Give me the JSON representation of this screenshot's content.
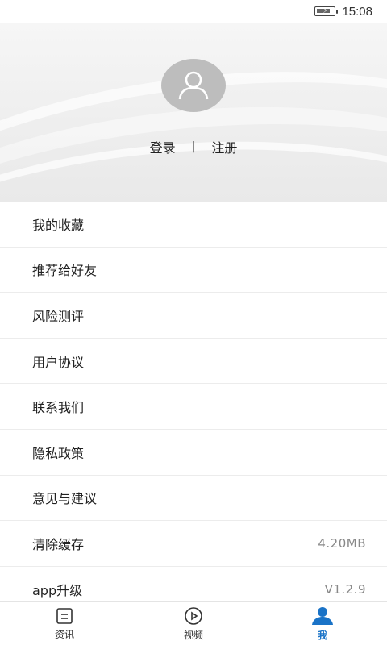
{
  "statusbar": {
    "time": "15:08",
    "battery_icon": "battery-charging-icon"
  },
  "profile": {
    "avatar_icon": "user-avatar-icon",
    "login_label": "登录",
    "separator": "|",
    "register_label": "注册"
  },
  "menu": {
    "items": [
      {
        "label": "我的收藏",
        "value": ""
      },
      {
        "label": "推荐给好友",
        "value": ""
      },
      {
        "label": "风险测评",
        "value": ""
      },
      {
        "label": "用户协议",
        "value": ""
      },
      {
        "label": "联系我们",
        "value": ""
      },
      {
        "label": "隐私政策",
        "value": ""
      },
      {
        "label": "意见与建议",
        "value": ""
      },
      {
        "label": "清除缓存",
        "value": "4.20MB"
      },
      {
        "label": "app升级",
        "value": "V1.2.9"
      }
    ]
  },
  "nav": {
    "tabs": [
      {
        "label": "资讯",
        "icon": "news-icon",
        "active": false
      },
      {
        "label": "视频",
        "icon": "video-play-icon",
        "active": false
      },
      {
        "label": "我",
        "icon": "profile-icon",
        "active": true
      }
    ],
    "active_color": "#1a73c7"
  }
}
